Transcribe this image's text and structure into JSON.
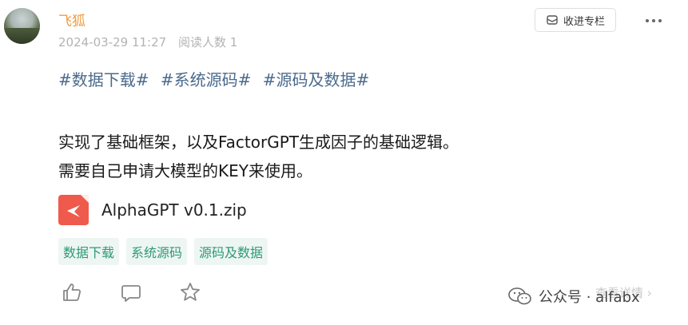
{
  "post": {
    "author": "飞狐",
    "date": "2024-03-29 11:27",
    "read_count": "阅读人数 1",
    "hashtags": [
      "#数据下载#",
      "#系统源码#",
      "#源码及数据#"
    ],
    "content_lines": [
      "实现了基础框架，以及FactorGPT生成因子的基础逻辑。",
      "需要自己申请大模型的KEY来使用。"
    ],
    "attachment": {
      "name": "AlphaGPT v0.1.zip",
      "icon": "file-share-icon"
    },
    "tags": [
      "数据下载",
      "系统源码",
      "源码及数据"
    ]
  },
  "header": {
    "collect_button": "收进专栏",
    "more_icon": "more-dots-icon"
  },
  "actions": {
    "like_icon": "thumbs-up-icon",
    "comment_icon": "comment-icon",
    "favorite_icon": "star-icon"
  },
  "footer": {
    "watermark": "公众号 · alfabx",
    "details": "查看详情 ›"
  },
  "colors": {
    "author": "#f09b3f",
    "hashtag": "#4a6a8c",
    "tag_text": "#2d9a76",
    "tag_bg": "#eef6f3",
    "file_icon": "#ef5a4c"
  }
}
